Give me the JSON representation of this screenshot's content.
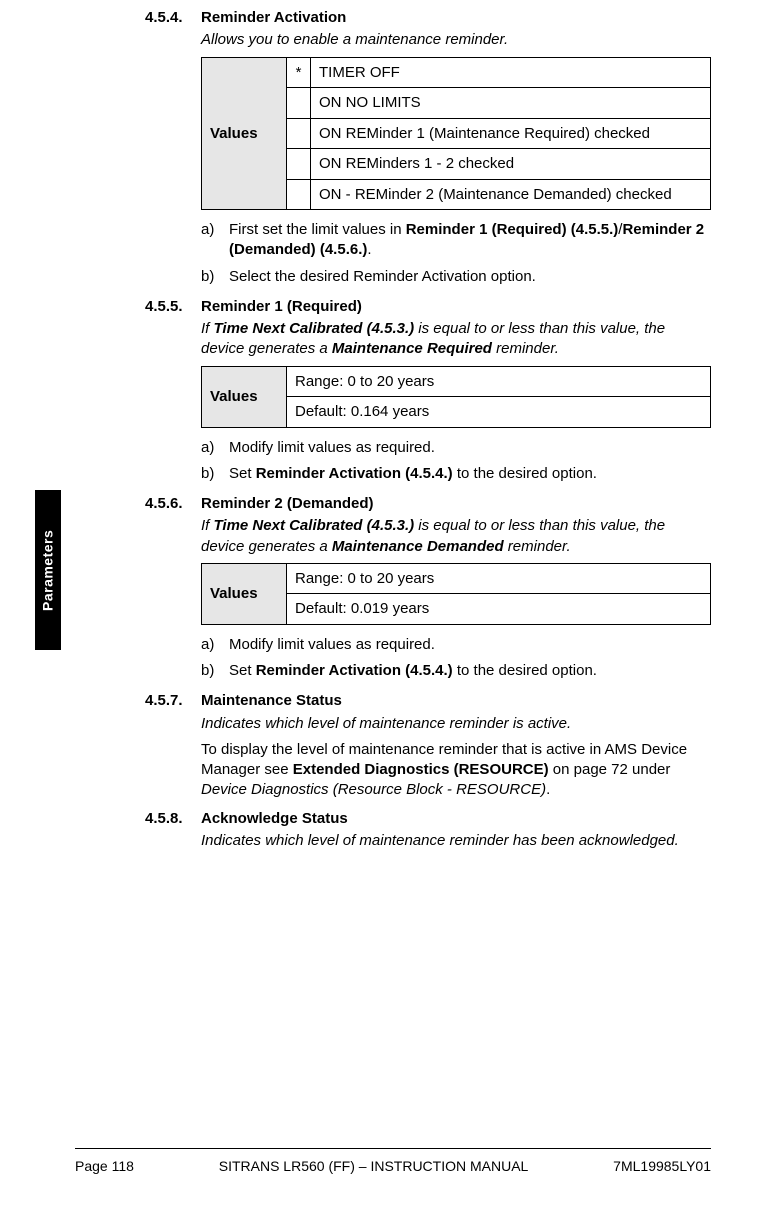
{
  "sidetab": "Parameters",
  "sections": {
    "s454": {
      "num": "4.5.4.",
      "title": "Reminder Activation",
      "desc": "Allows you to enable a maintenance reminder.",
      "table_label": "Values",
      "default_mark": "*",
      "rows": {
        "r0": "TIMER OFF",
        "r1": "ON NO LIMITS",
        "r2": "ON REMinder 1 (Maintenance Required) checked",
        "r3": "ON REMinders 1 - 2 checked",
        "r4": "ON - REMinder 2 (Maintenance Demanded) checked"
      },
      "steps": {
        "a_marker": "a)",
        "a_pre": "First set the limit values in ",
        "a_bold1": "Reminder 1 (Required) (4.5.5.)",
        "a_mid": "/",
        "a_bold2": "Reminder 2 (Demanded) (4.5.6.)",
        "a_post": ".",
        "b_marker": "b)",
        "b_text": "Select the desired Reminder Activation option."
      }
    },
    "s455": {
      "num": "4.5.5.",
      "title": "Reminder 1 (Required)",
      "desc_pre": "If ",
      "desc_b1": "Time Next Calibrated (4.5.3.)",
      "desc_mid": " is equal to or less than this value, the device generates a ",
      "desc_b2": "Maintenance Required",
      "desc_post": " reminder.",
      "table_label": "Values",
      "row_range": "Range: 0 to 20 years",
      "row_default": "Default: 0.164 years",
      "steps": {
        "a_marker": "a)",
        "a_text": "Modify limit values as required.",
        "b_marker": "b)",
        "b_pre": "Set ",
        "b_bold": "Reminder Activation (4.5.4.)",
        "b_post": " to the desired option."
      }
    },
    "s456": {
      "num": "4.5.6.",
      "title": "Reminder 2 (Demanded)",
      "desc_pre": "If ",
      "desc_b1": "Time Next Calibrated (4.5.3.)",
      "desc_mid": " is equal to or less than this value, the device generates a ",
      "desc_b2": "Maintenance Demanded",
      "desc_post": " reminder.",
      "table_label": "Values",
      "row_range": "Range: 0 to 20 years",
      "row_default": "Default: 0.019 years",
      "steps": {
        "a_marker": "a)",
        "a_text": "Modify limit values as required.",
        "b_marker": "b)",
        "b_pre": "Set ",
        "b_bold": "Reminder Activation (4.5.4.)",
        "b_post": " to the desired option."
      }
    },
    "s457": {
      "num": "4.5.7.",
      "title": "Maintenance Status",
      "desc_italic": "Indicates which level of maintenance reminder is active.",
      "para_pre": "To display the level of maintenance reminder that is active in AMS Device Manager see ",
      "para_bold": "Extended Diagnostics (RESOURCE)",
      "para_mid": " on page 72 under ",
      "para_italic": "Device Diagnostics (Resource Block - RESOURCE)",
      "para_post": "."
    },
    "s458": {
      "num": "4.5.8.",
      "title": "Acknowledge Status",
      "desc_italic": "Indicates which level of maintenance reminder has been acknowledged."
    }
  },
  "footer": {
    "left": "Page 118",
    "center": "SITRANS LR560 (FF) – INSTRUCTION MANUAL",
    "right": "7ML19985LY01"
  }
}
